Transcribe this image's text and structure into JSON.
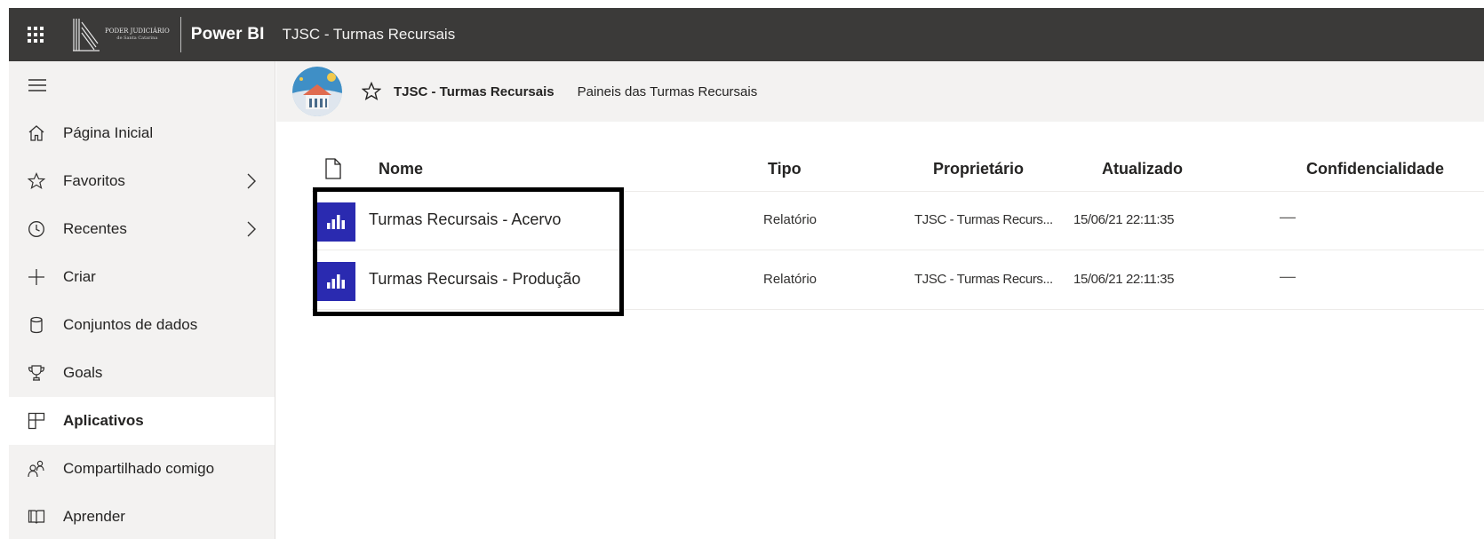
{
  "topbar": {
    "brand": "Power BI",
    "workspace_title": "TJSC - Turmas Recursais",
    "logo": {
      "line1": "PODER JUDICIÁRIO",
      "line2": "de Santa Catarina"
    }
  },
  "sidebar": {
    "items": [
      {
        "label": "Página Inicial",
        "icon": "home-icon",
        "chevron": false,
        "active": false
      },
      {
        "label": "Favoritos",
        "icon": "star-icon",
        "chevron": true,
        "active": false
      },
      {
        "label": "Recentes",
        "icon": "clock-icon",
        "chevron": true,
        "active": false
      },
      {
        "label": "Criar",
        "icon": "plus-icon",
        "chevron": false,
        "active": false
      },
      {
        "label": "Conjuntos de dados",
        "icon": "database-icon",
        "chevron": false,
        "active": false
      },
      {
        "label": "Goals",
        "icon": "trophy-icon",
        "chevron": false,
        "active": false
      },
      {
        "label": "Aplicativos",
        "icon": "apps-icon",
        "chevron": false,
        "active": true
      },
      {
        "label": "Compartilhado comigo",
        "icon": "shared-icon",
        "chevron": false,
        "active": false
      },
      {
        "label": "Aprender",
        "icon": "book-icon",
        "chevron": false,
        "active": false
      }
    ]
  },
  "header": {
    "app_name": "TJSC - Turmas Recursais",
    "app_description": "Paineis das Turmas Recursais"
  },
  "table": {
    "columns": {
      "nome": "Nome",
      "tipo": "Tipo",
      "proprietario": "Proprietário",
      "atualizado": "Atualizado",
      "confidencialidade": "Confidencialidade"
    },
    "rows": [
      {
        "name": "Turmas Recursais - Acervo",
        "type": "Relatório",
        "owner": "TJSC - Turmas Recurs...",
        "updated": "15/06/21 22:11:35",
        "sensitivity": "—"
      },
      {
        "name": "Turmas Recursais - Produção",
        "type": "Relatório",
        "owner": "TJSC - Turmas Recurs...",
        "updated": "15/06/21 22:11:35",
        "sensitivity": "—"
      }
    ]
  },
  "colors": {
    "topbar_bg": "#3b3a39",
    "sidebar_bg": "#f3f2f1",
    "report_icon_bg": "#2a2ab0",
    "highlight_border": "#000000"
  }
}
